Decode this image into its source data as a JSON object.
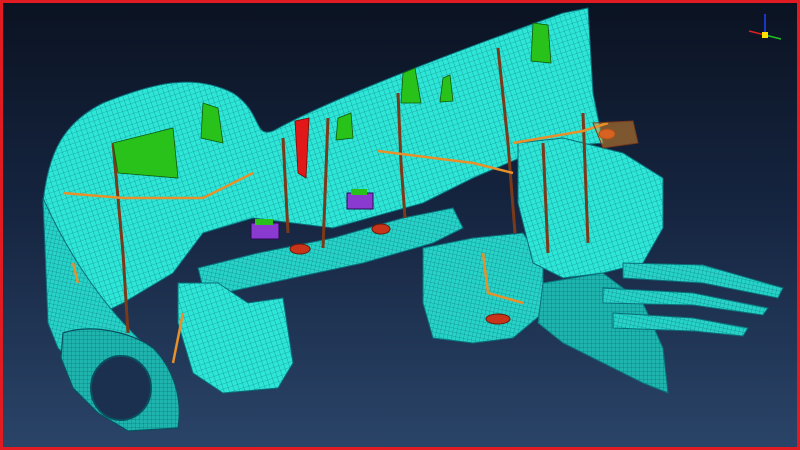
{
  "viewport": {
    "border_color": "#e01b22",
    "background_top": "#0b1322",
    "background_bottom": "#2a4468"
  },
  "model": {
    "mesh_color": "#2ee6d6",
    "mesh_line_color": "#0a6f7a",
    "edge_color": "#7a4a2a",
    "rib_green": "#29c21a",
    "rib_red": "#e01818",
    "weld_orange": "#e8902a",
    "spot_red": "#c8341a"
  },
  "triad": {
    "x_axis_color": "#e02020",
    "y_axis_color": "#20c020",
    "z_axis_color": "#2040ff",
    "origin_color": "#ffe000"
  }
}
